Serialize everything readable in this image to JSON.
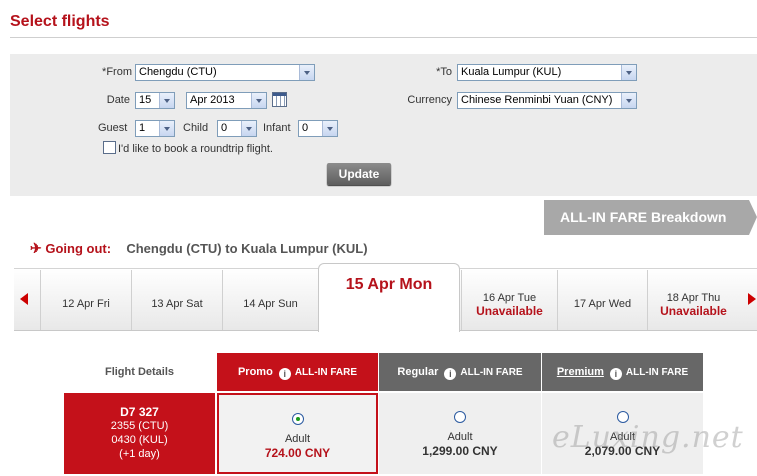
{
  "page": {
    "title": "Select flights"
  },
  "search": {
    "from_label": "*From",
    "from_value": "Chengdu (CTU)",
    "to_label": "*To",
    "to_value": "Kuala Lumpur (KUL)",
    "date_label": "Date",
    "date_day": "15",
    "date_month": "Apr 2013",
    "currency_label": "Currency",
    "currency_value": "Chinese Renminbi Yuan (CNY)",
    "guest_label": "Guest",
    "guest_value": "1",
    "child_label": "Child",
    "child_value": "0",
    "infant_label": "Infant",
    "infant_value": "0",
    "roundtrip_label": "I'd like to book a roundtrip flight.",
    "update_label": "Update"
  },
  "allin_button": {
    "label": "ALL-IN FARE Breakdown"
  },
  "going_out": {
    "label": "Going out:",
    "origin": "Chengdu (CTU)",
    "to_word": "to",
    "destination": "Kuala Lumpur (KUL)"
  },
  "dates": [
    {
      "label": "12 Apr Fri",
      "status": ""
    },
    {
      "label": "13 Apr Sat",
      "status": ""
    },
    {
      "label": "14 Apr Sun",
      "status": ""
    },
    {
      "label": "15 Apr Mon",
      "status": ""
    },
    {
      "label": "16 Apr Tue",
      "status": "Unavailable"
    },
    {
      "label": "17 Apr Wed",
      "status": ""
    },
    {
      "label": "18 Apr Thu",
      "status": "Unavailable"
    }
  ],
  "fare_table": {
    "details_header": "Flight Details",
    "columns": [
      {
        "name": "Promo",
        "tag": "ALL-IN FARE"
      },
      {
        "name": "Regular",
        "tag": "ALL-IN FARE"
      },
      {
        "name": "Premium",
        "tag": "ALL-IN FARE"
      }
    ],
    "flight": {
      "number": "D7  327",
      "depart": "2355  (CTU)",
      "arrive": "0430  (KUL)",
      "day_note": "(+1 day)"
    },
    "fares": [
      {
        "pax": "Adult",
        "price": "724.00 CNY",
        "selected": true
      },
      {
        "pax": "Adult",
        "price": "1,299.00 CNY",
        "selected": false
      },
      {
        "pax": "Adult",
        "price": "2,079.00 CNY",
        "selected": false
      }
    ]
  },
  "watermark": "eLuxing.net"
}
